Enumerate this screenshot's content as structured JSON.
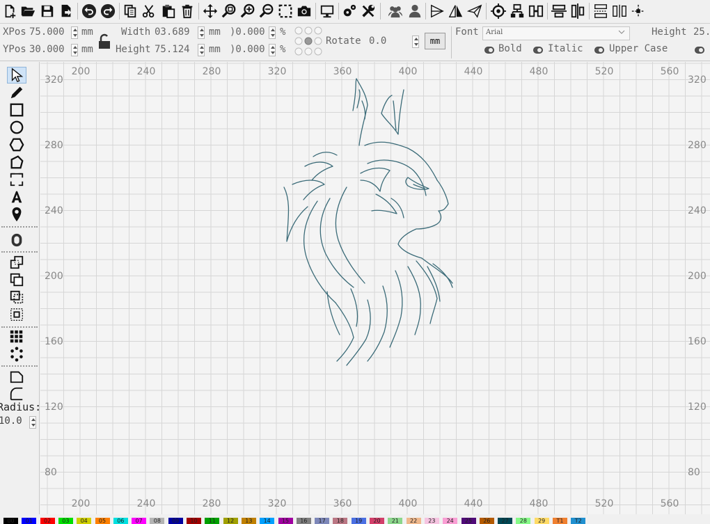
{
  "toolbar": {
    "icons": [
      "new-file-icon",
      "open-folder-icon",
      "save-icon",
      "export-icon",
      "undo-icon",
      "redo-icon",
      "copy-icon",
      "cut-icon",
      "paste-icon",
      "delete-icon",
      "move-icon",
      "zoom-page-icon",
      "zoom-in-icon",
      "zoom-out-icon",
      "zoom-selection-icon",
      "camera-icon",
      "monitor-icon",
      "settings-icon",
      "tools-icon",
      "group-icon",
      "user-icon",
      "mirror-horizontal-icon",
      "mirror-vertical-icon",
      "send-icon",
      "target-icon",
      "align-tree-icon",
      "align-bridge-icon",
      "align-center-horizontal-icon",
      "align-center-vertical-icon",
      "distribute-horizontal-icon",
      "distribute-width-icon",
      "distribute-height-icon"
    ]
  },
  "props": {
    "xpos_label": "XPos",
    "xpos_value": "75.000",
    "ypos_label": "YPos",
    "ypos_value": "30.000",
    "unit_mm": "mm",
    "width_label": "Width",
    "width_value": "03.689",
    "height_label": "Height",
    "height_value": "75.124",
    "scale_w": ")0.000",
    "scale_h": ")0.000",
    "percent": "%",
    "rotate_label": "Rotate",
    "rotate_value": "0.0",
    "mm_button": "mm",
    "font_label": "Font",
    "font_value": "Arial",
    "text_height_label": "Height",
    "text_height_value": "25.",
    "bold_label": "Bold",
    "italic_label": "Italic",
    "upper_case_label": "Upper Case"
  },
  "palette": {
    "tools": [
      "select-tool-icon",
      "pencil-tool-icon",
      "rectangle-tool-icon",
      "ellipse-tool-icon",
      "hexagon-tool-icon",
      "polygon-tool-icon",
      "bracket-rect-tool-icon",
      "text-tool-icon",
      "position-tool-icon",
      "offset-tool-icon",
      "weld-icon",
      "union-icon",
      "subtract-icon",
      "intersect-icon",
      "grid-array-icon",
      "circular-array-icon",
      "corner-cut-icon",
      "corner-round-icon"
    ],
    "radius_label": "Radius:",
    "radius_value": "10.0"
  },
  "rulers": {
    "x_labels": [
      "200",
      "240",
      "280",
      "320",
      "360",
      "400",
      "440",
      "480",
      "520",
      "560"
    ],
    "y_labels": [
      "320",
      "280",
      "240",
      "200",
      "160",
      "120",
      "80"
    ]
  },
  "colors": {
    "grid_line": "#d6d6d6",
    "artwork_stroke": "#3b6b78",
    "canvas_bg": "#f4f4f4"
  },
  "colorbar": [
    {
      "label": "00",
      "color": "#000000"
    },
    {
      "label": "01",
      "color": "#0000ff"
    },
    {
      "label": "02",
      "color": "#ff0000"
    },
    {
      "label": "03",
      "color": "#00e000"
    },
    {
      "label": "04",
      "color": "#d0d000"
    },
    {
      "label": "05",
      "color": "#ff8000"
    },
    {
      "label": "06",
      "color": "#00e0e0"
    },
    {
      "label": "07",
      "color": "#ff00ff"
    },
    {
      "label": "08",
      "color": "#b4b4b4"
    },
    {
      "label": "09",
      "color": "#0000a0"
    },
    {
      "label": "10",
      "color": "#a00000"
    },
    {
      "label": "11",
      "color": "#00a000"
    },
    {
      "label": "12",
      "color": "#a0a000"
    },
    {
      "label": "13",
      "color": "#c08000"
    },
    {
      "label": "14",
      "color": "#00a0ff"
    },
    {
      "label": "15",
      "color": "#a000a0"
    },
    {
      "label": "16",
      "color": "#808080"
    },
    {
      "label": "17",
      "color": "#7d87b9"
    },
    {
      "label": "18",
      "color": "#bb7784"
    },
    {
      "label": "19",
      "color": "#4a6fe3"
    },
    {
      "label": "20",
      "color": "#d33f6a"
    },
    {
      "label": "21",
      "color": "#8cd78c"
    },
    {
      "label": "22",
      "color": "#f0b98d"
    },
    {
      "label": "23",
      "color": "#f6c4e1"
    },
    {
      "label": "24",
      "color": "#fa9ed4"
    },
    {
      "label": "25",
      "color": "#500a78"
    },
    {
      "label": "26",
      "color": "#b45a00"
    },
    {
      "label": "27",
      "color": "#004754"
    },
    {
      "label": "28",
      "color": "#86fa88"
    },
    {
      "label": "29",
      "color": "#ffdb66"
    },
    {
      "label": "T1",
      "color": "#f08030"
    },
    {
      "label": "T2",
      "color": "#2090d0"
    }
  ]
}
